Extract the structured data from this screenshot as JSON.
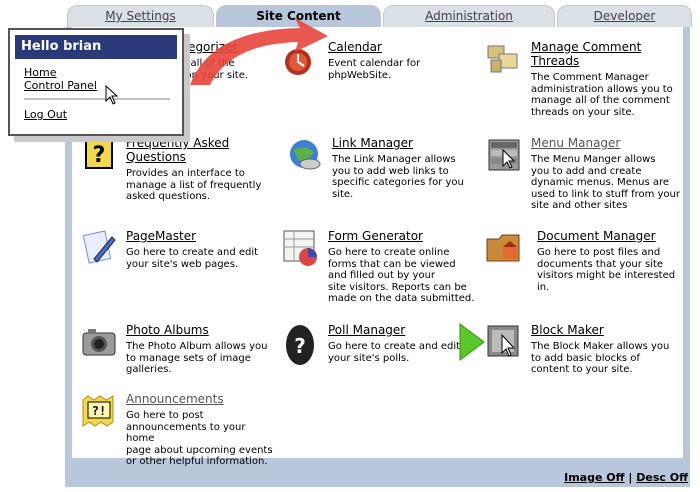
{
  "tabs": [
    {
      "label": "My Settings",
      "active": false
    },
    {
      "label": "Site Content",
      "active": true
    },
    {
      "label": "Administration",
      "active": false
    },
    {
      "label": "Developer",
      "active": false
    }
  ],
  "modules": [
    {
      "title": "Categorizer",
      "title_visible": "ategorizer",
      "desc": "es all of the\nn on your site.",
      "icon": "categorizer-icon"
    },
    {
      "title": "Calendar",
      "desc": "Event calendar for\nphpWebSite.",
      "icon": "calendar-icon"
    },
    {
      "title": "Manage Comment\nThreads",
      "desc": "The Comment Manager\nadministration allows you to\nmanage all of the comment\nthreads on your site.",
      "icon": "comments-icon"
    },
    {
      "title": "Frequently Asked\nQuestions",
      "desc": "Provides an interface to\nmanage a list of frequently\nasked questions.",
      "icon": "faq-icon"
    },
    {
      "title": "Link Manager",
      "desc": "The Link Manager allows\nyou to add web links to\nspecific categories for you\nsite.",
      "icon": "link-manager-icon"
    },
    {
      "title": "Menu Manager",
      "desc": "The Menu Manger allows\nyou to add and create\ndynamic menus. Menus are\nused to link to stuff from your\nsite and other sites",
      "icon": "menu-manager-icon"
    },
    {
      "title": "PageMaster",
      "desc": "Go here to create and edit\nyour site's web pages.",
      "icon": "pagemaster-icon"
    },
    {
      "title": "Form Generator",
      "desc": "Go here to create online\nforms that can be viewed\nand filled out by your\nsite visitors. Reports can be\nmade on the data submitted.",
      "icon": "form-generator-icon"
    },
    {
      "title": "Document Manager",
      "desc": "Go here to post files and\ndocuments that your site\nvisitors might be interested\nin.",
      "icon": "document-manager-icon"
    },
    {
      "title": "Photo Albums",
      "desc": "The Photo Album allows you\nto manage sets of image\ngalleries.",
      "icon": "photo-albums-icon"
    },
    {
      "title": "Poll Manager",
      "desc": "Go here to create and edit\nyour site's polls.",
      "icon": "poll-manager-icon"
    },
    {
      "title": "Block Maker",
      "desc": "The Block Maker allows you\nto add basic blocks of\ncontent to your site.",
      "icon": "block-maker-icon"
    },
    {
      "title": "Announcements",
      "desc": "Go here to post\nannouncements to your home\npage about upcoming events\nor other helpful information.",
      "icon": "announcements-icon"
    }
  ],
  "footer": {
    "image_off": "Image Off",
    "separator": "|",
    "desc_off": "Desc Off"
  },
  "popup": {
    "greeting": "Hello brian",
    "home": "Home",
    "control_panel": "Control Panel",
    "logout": "Log Out"
  },
  "colors": {
    "panel": "#b9c7dd",
    "popup_header": "#2a3a78",
    "arrow_red": "#e8453c",
    "arrow_green": "#5ac82a"
  }
}
